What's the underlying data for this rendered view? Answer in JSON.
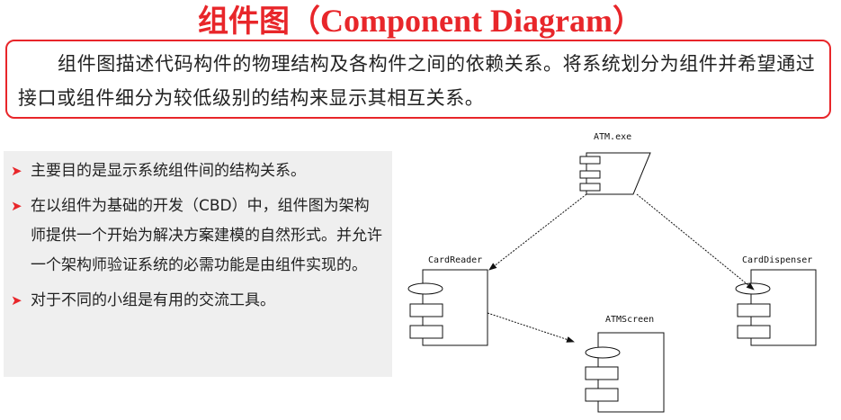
{
  "title": {
    "cn": "组件图",
    "open": "（",
    "en": "Component Diagram",
    "close": "）"
  },
  "intro": "组件图描述代码构件的物理结构及各构件之间的依赖关系。将系统划分为组件并希望通过接口或组件细分为较低级别的结构来显示其相互关系。",
  "bullets": [
    "主要目的是显示系统组件间的结构关系。",
    "在以组件为基础的开发（CBD）中，组件图为架构师提供一个开始为解决方案建模的自然形式。并允许一个架构师验证系统的必需功能是由组件实现的。",
    "对于不同的小组是有用的交流工具。"
  ],
  "diagram": {
    "nodes": [
      "ATM.exe",
      "CardReader",
      "CardDispenser",
      "ATMScreen"
    ],
    "edges": [
      [
        "ATM.exe",
        "CardReader"
      ],
      [
        "ATM.exe",
        "CardDispenser"
      ],
      [
        "CardReader",
        "ATMScreen"
      ]
    ]
  },
  "colors": {
    "accent": "#e8262a",
    "panel": "#efefef",
    "text": "#222222"
  }
}
